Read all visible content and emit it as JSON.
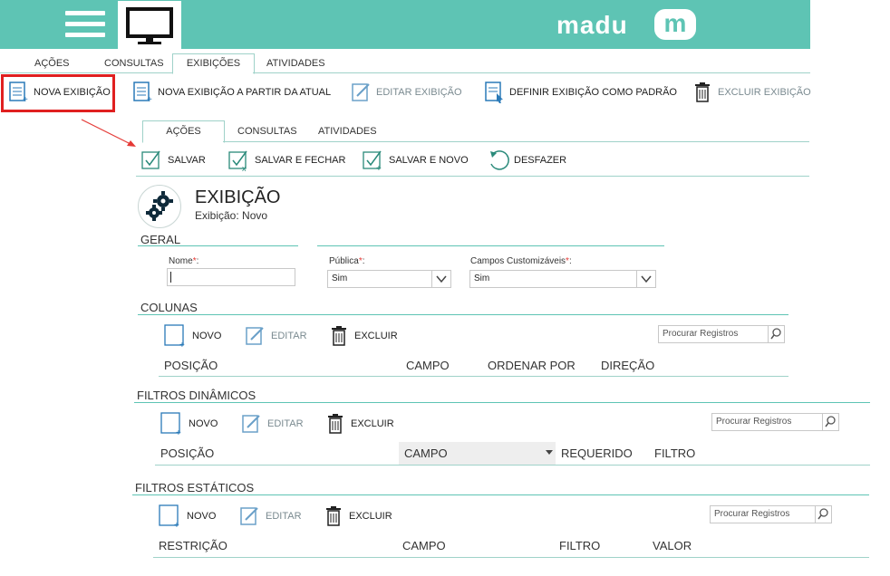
{
  "header": {
    "brand": "madu",
    "logo_letter": "m",
    "menu_icon": "hamburger-icon",
    "monitor_icon": "monitor-icon"
  },
  "top_tabs": [
    "AÇÕES",
    "CONSULTAS",
    "EXIBIÇÕES",
    "ATIVIDADES"
  ],
  "top_toolbar": {
    "new_view": "NOVA EXIBIÇÃO",
    "new_view_from_current": "NOVA EXIBIÇÃO A PARTIR DA ATUAL",
    "edit_view": "EDITAR EXIBIÇÃO",
    "set_default": "DEFINIR EXIBIÇÃO COMO PADRÃO",
    "delete_view": "EXCLUIR EXIBIÇÃO"
  },
  "form_tabs": [
    "AÇÕES",
    "CONSULTAS",
    "ATIVIDADES"
  ],
  "form_toolbar": {
    "save": "SALVAR",
    "save_close": "SALVAR E FECHAR",
    "save_new": "SALVAR E NOVO",
    "undo": "DESFAZER"
  },
  "record": {
    "title": "EXIBIÇÃO",
    "subtitle": "Exibição: Novo",
    "icon": "gears-icon"
  },
  "general": {
    "section": "GERAL",
    "name_label": "Nome",
    "name_value": "",
    "public_label": "Pública",
    "public_value": "Sim",
    "custom_fields_label": "Campos Customizáveis",
    "custom_fields_value": "Sim",
    "required_mark": "*",
    "colon": ":"
  },
  "grid_actions": {
    "new": "NOVO",
    "edit": "EDITAR",
    "delete": "EXCLUIR"
  },
  "search_placeholder": "Procurar Registros",
  "colunas": {
    "section": "COLUNAS",
    "columns": [
      "POSIÇÃO",
      "CAMPO",
      "ORDENAR POR",
      "DIREÇÃO"
    ]
  },
  "filtros_dinamicos": {
    "section": "FILTROS DINÂMICOS",
    "columns": [
      "POSIÇÃO",
      "CAMPO",
      "REQUERIDO",
      "FILTRO"
    ]
  },
  "filtros_estaticos": {
    "section": "FILTROS ESTÁTICOS",
    "columns": [
      "RESTRIÇÃO",
      "CAMPO",
      "FILTRO",
      "VALOR"
    ]
  },
  "colors": {
    "brand": "#5ec4b4",
    "highlight": "#e02020",
    "icon": "#2a7ab8"
  }
}
